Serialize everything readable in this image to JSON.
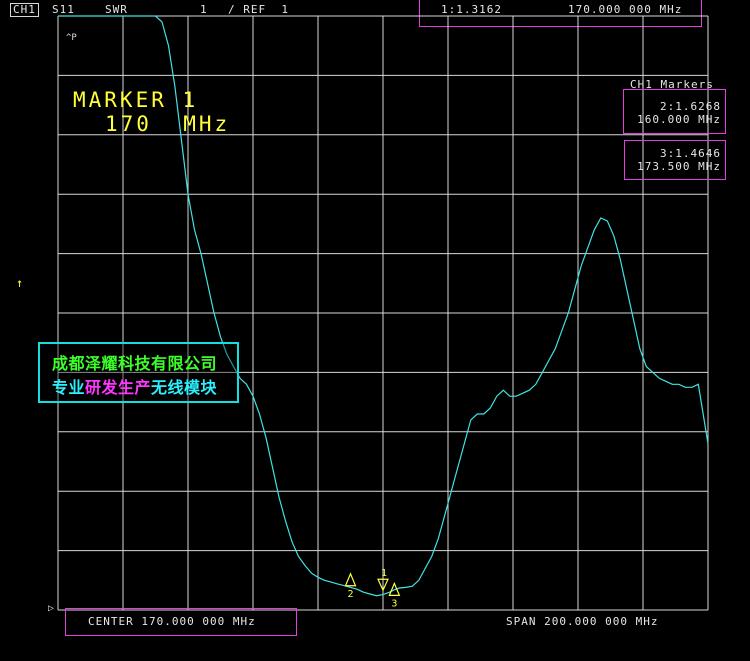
{
  "colors": {
    "trace": "#3fe3e3",
    "grid": "#d8d8d8",
    "marker": "#ffff3a",
    "box": "#e040e0"
  },
  "header": {
    "channel": "CH1",
    "param": "S11",
    "format": "SWR",
    "scale": "1",
    "ref": "/ REF  1",
    "active_marker_value": "1:1.3162",
    "active_marker_freq": "170.000 000 MHz"
  },
  "plot": {
    "ap_label": "^P",
    "marker_title": "MARKER 1",
    "marker_freq": "170  MHz",
    "ref_arrow": "↑",
    "ref_pointer": "▷"
  },
  "marker_panel": {
    "title": "CH1 Markers",
    "m2_value": "2:1.6268",
    "m2_freq": "160.000 MHz",
    "m3_value": "3:1.4646",
    "m3_freq": "173.500 MHz"
  },
  "marker_labels": {
    "m1": "1",
    "m2": "2",
    "m3": "3"
  },
  "footer": {
    "center": "CENTER 170.000 000 MHz",
    "span": "SPAN 200.000 000 MHz"
  },
  "watermark": {
    "line1": "成都泽耀科技有限公司",
    "line2_a": "专业",
    "line2_b": "研发生产",
    "line2_c": "无线模块"
  },
  "chart_data": {
    "type": "line",
    "title": "S11 SWR",
    "x_center_mhz": 170,
    "x_span_mhz": 200,
    "xlim": [
      70,
      270
    ],
    "y_scale_per_div": 1,
    "y_ref": 1,
    "ylim": [
      1,
      11
    ],
    "grid": true,
    "series": [
      {
        "name": "S11 SWR",
        "x": [
          70,
          80,
          90,
          92,
          94,
          96,
          98,
          100,
          102,
          104,
          106,
          108,
          110,
          112,
          114,
          116,
          118,
          120,
          122,
          124,
          126,
          128,
          130,
          132,
          134,
          136,
          138,
          140,
          142,
          144,
          146,
          148,
          150,
          152,
          154,
          156,
          158,
          160,
          162,
          164,
          166,
          168,
          170,
          172,
          173.5,
          175,
          177,
          179,
          181,
          183,
          185,
          187,
          189,
          191,
          193,
          195,
          197,
          199,
          201,
          203,
          205,
          207,
          209,
          211,
          213,
          215,
          217,
          219,
          221,
          223,
          225,
          227,
          229,
          231,
          233,
          235,
          237,
          239,
          241,
          243,
          245,
          247,
          249,
          251,
          253,
          255,
          257,
          259,
          261,
          263,
          265,
          267,
          270
        ],
        "y": [
          11,
          11,
          11,
          11,
          11,
          11,
          11,
          11,
          10.9,
          10.5,
          9.8,
          8.9,
          8.0,
          7.4,
          7.0,
          6.5,
          6.0,
          5.6,
          5.3,
          5.1,
          4.9,
          4.8,
          4.6,
          4.3,
          3.9,
          3.4,
          2.9,
          2.5,
          2.15,
          1.9,
          1.75,
          1.62,
          1.55,
          1.5,
          1.47,
          1.44,
          1.41,
          1.38,
          1.35,
          1.3,
          1.27,
          1.24,
          1.26,
          1.3,
          1.34,
          1.37,
          1.38,
          1.4,
          1.5,
          1.7,
          1.9,
          2.2,
          2.6,
          3.0,
          3.4,
          3.8,
          4.2,
          4.3,
          4.3,
          4.4,
          4.6,
          4.7,
          4.6,
          4.6,
          4.65,
          4.7,
          4.8,
          5.0,
          5.2,
          5.4,
          5.7,
          6.0,
          6.4,
          6.8,
          7.1,
          7.4,
          7.6,
          7.55,
          7.3,
          6.9,
          6.4,
          5.9,
          5.4,
          5.1,
          5.0,
          4.9,
          4.85,
          4.8,
          4.8,
          4.75,
          4.75,
          4.8,
          3.8
        ]
      }
    ],
    "markers": [
      {
        "id": 1,
        "x": 170,
        "y": 1.3162
      },
      {
        "id": 2,
        "x": 160,
        "y": 1.6268
      },
      {
        "id": 3,
        "x": 173.5,
        "y": 1.4646
      }
    ]
  }
}
